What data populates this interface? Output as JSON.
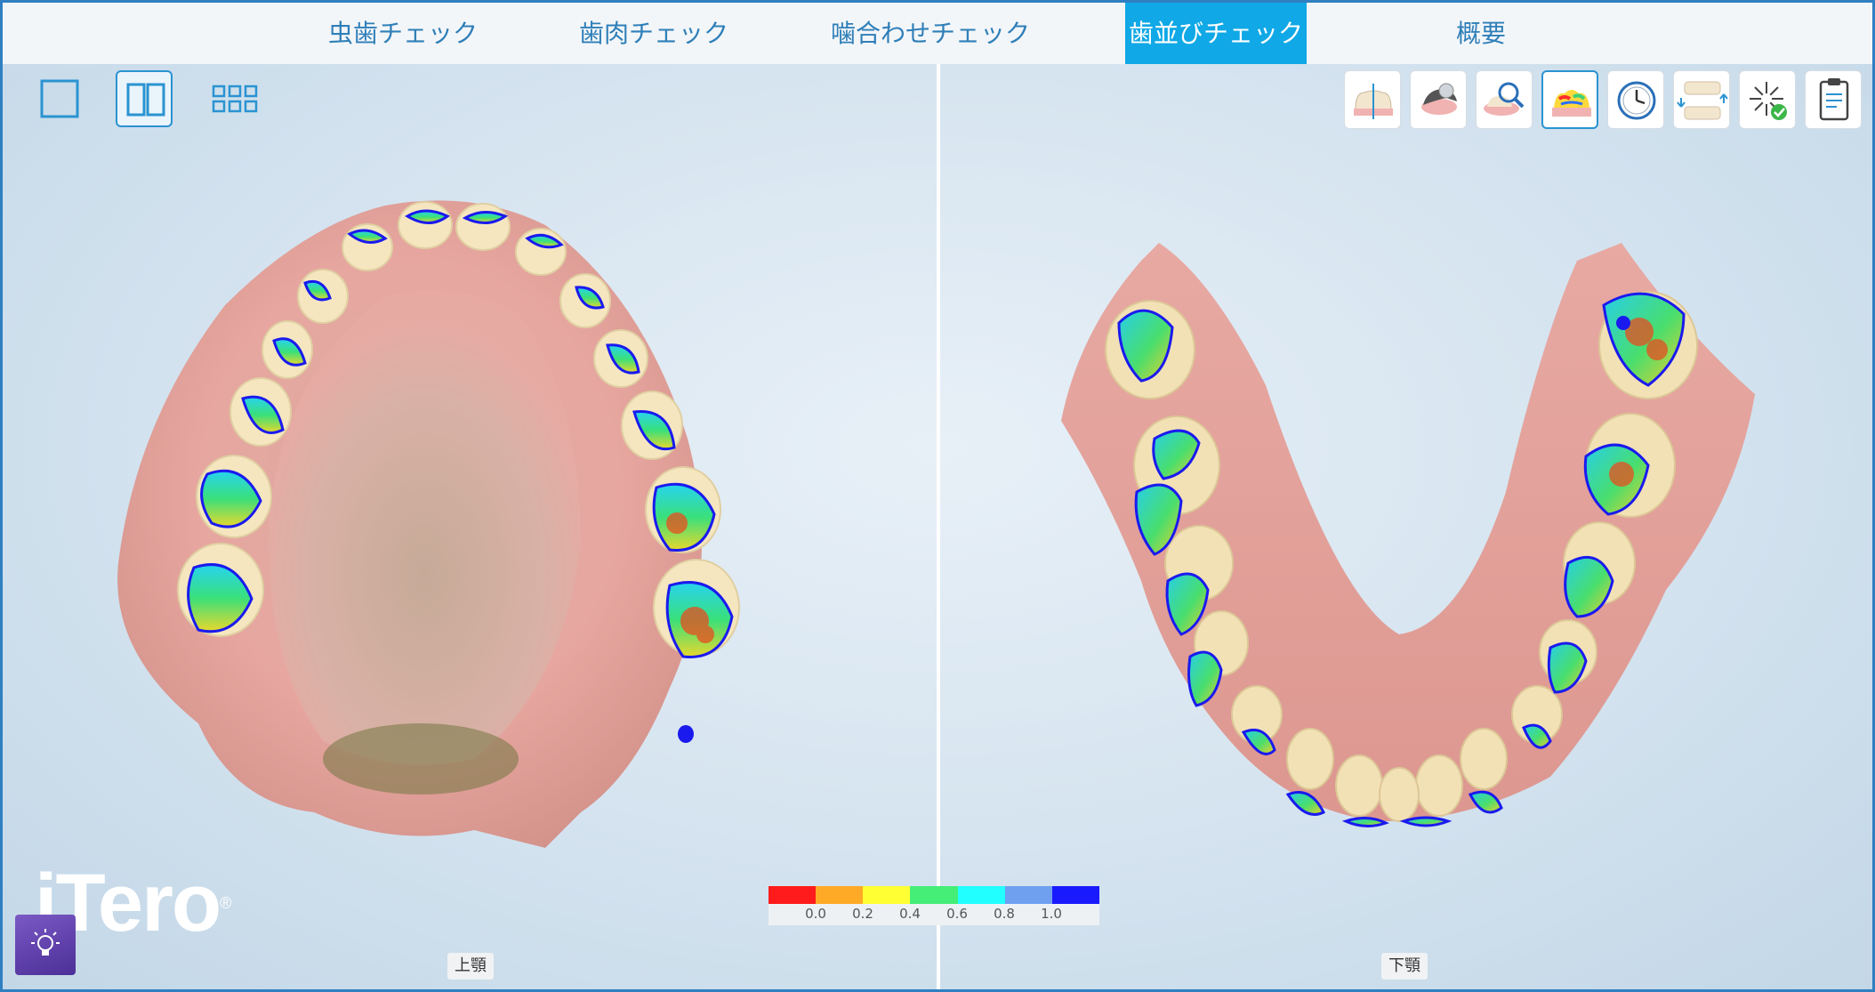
{
  "tabs": [
    {
      "label": "虫歯チェック",
      "active": false
    },
    {
      "label": "歯肉チェック",
      "active": false
    },
    {
      "label": "噛合わせチェック",
      "active": false
    },
    {
      "label": "歯並びチェック",
      "active": true
    },
    {
      "label": "概要",
      "active": false
    }
  ],
  "view_buttons": [
    {
      "icon": "single-view-icon",
      "selected": false
    },
    {
      "icon": "dual-view-icon",
      "selected": true
    },
    {
      "icon": "quad-view-icon",
      "selected": false
    }
  ],
  "tools": [
    {
      "icon": "tooth-section-icon",
      "selected": false
    },
    {
      "icon": "scanner-icon",
      "selected": false
    },
    {
      "icon": "magnify-tooth-icon",
      "selected": false
    },
    {
      "icon": "heatmap-tooth-icon",
      "selected": true
    },
    {
      "icon": "timelapse-clock-icon",
      "selected": false
    },
    {
      "icon": "jaw-compare-icon",
      "selected": false
    },
    {
      "icon": "sparkle-check-icon",
      "selected": false
    },
    {
      "icon": "clipboard-icon",
      "selected": false
    }
  ],
  "jaws": {
    "upper_label": "上顎",
    "lower_label": "下顎"
  },
  "scale": {
    "colors": [
      "#ff1b1b",
      "#ffaa26",
      "#ffff33",
      "#44ee77",
      "#22ffff",
      "#6fa0f0",
      "#1a1aff"
    ],
    "ticks": [
      "0.0",
      "0.2",
      "0.4",
      "0.6",
      "0.8",
      "1.0"
    ]
  },
  "brand": {
    "logo_text": "iTero",
    "registered": "®"
  },
  "help_icon": "lightbulb-icon"
}
